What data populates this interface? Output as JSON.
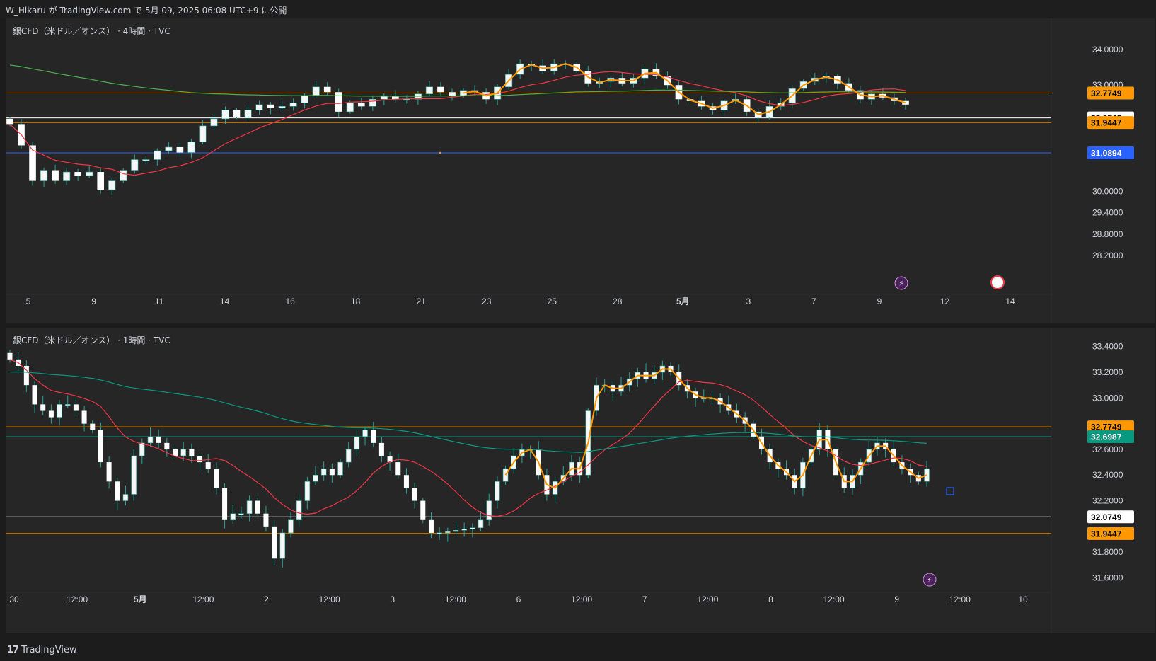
{
  "header": {
    "published": "W_Hikaru が TradingView.com で 5月 09, 2025 06:08 UTC+9 に公開"
  },
  "footer": {
    "brand": "TradingView",
    "logo": "tradingview-logo-icon"
  },
  "colors": {
    "up": "#ffffff",
    "down": "#ffffff",
    "wick": "#26a69a",
    "ma_fast": "#f23645",
    "ma_slow_top": "#4caf50",
    "ma_slow_bottom": "#089981",
    "zigzag": "#ff9800",
    "orange_line": "#ff9800",
    "white_line": "#ffffff",
    "blue_line": "#2962ff",
    "teal_line": "#089981"
  },
  "chart_data": [
    {
      "type": "candlestick",
      "title": "銀CFD（米ドル／オンス） · 4時間 · TVC",
      "x_ticks": [
        "5",
        "9",
        "11",
        "14",
        "16",
        "18",
        "21",
        "23",
        "25",
        "28",
        "5月",
        "3",
        "7",
        "9",
        "12",
        "14"
      ],
      "y_ticks": [
        "34.0000",
        "33.0000",
        "30.0000",
        "29.4000",
        "28.8000",
        "28.2000"
      ],
      "ylim": [
        27.5,
        34.6
      ],
      "price_labels": [
        {
          "value": "32.7749",
          "color": "#ff9800"
        },
        {
          "value": "32.0749",
          "color": "#ffffff"
        },
        {
          "value": "31.9447",
          "color": "#ff9800"
        },
        {
          "value": "31.0894",
          "color": "#2962ff"
        }
      ],
      "closes": [
        31.9,
        31.3,
        30.3,
        30.6,
        30.3,
        30.55,
        30.45,
        30.55,
        30.05,
        30.3,
        30.6,
        30.9,
        30.9,
        31.15,
        31.25,
        31.1,
        31.4,
        31.85,
        32.05,
        32.3,
        32.1,
        32.3,
        32.45,
        32.35,
        32.4,
        32.5,
        32.7,
        32.95,
        32.8,
        32.25,
        32.5,
        32.4,
        32.6,
        32.7,
        32.6,
        32.6,
        32.75,
        32.95,
        32.8,
        32.7,
        32.85,
        32.8,
        32.6,
        32.95,
        33.3,
        33.6,
        33.55,
        33.4,
        33.6,
        33.6,
        33.4,
        33.05,
        33.1,
        33.2,
        33.05,
        33.2,
        33.45,
        33.25,
        33.0,
        32.6,
        32.55,
        32.4,
        32.3,
        32.55,
        32.6,
        32.25,
        32.1,
        32.4,
        32.5,
        32.9,
        33.1,
        33.2,
        33.25,
        33.05,
        32.85,
        32.6,
        32.75,
        32.65,
        32.55,
        32.45
      ],
      "annotations": [
        "lightning-event-icon",
        "us-flag-icon"
      ]
    },
    {
      "type": "candlestick",
      "title": "銀CFD（米ドル／オンス） · 1時間 · TVC",
      "x_ticks": [
        "30",
        "12:00",
        "5月",
        "12:00",
        "2",
        "12:00",
        "3",
        "12:00",
        "6",
        "12:00",
        "7",
        "12:00",
        "8",
        "12:00",
        "9",
        "12:00",
        "10"
      ],
      "y_ticks": [
        "33.4000",
        "33.2000",
        "33.0000",
        "32.6000",
        "32.4000",
        "32.2000",
        "31.8000",
        "31.6000"
      ],
      "ylim": [
        31.52,
        33.47
      ],
      "price_labels": [
        {
          "value": "32.7749",
          "color": "#ff9800"
        },
        {
          "value": "32.6987",
          "color": "#089981"
        },
        {
          "value": "32.0749",
          "color": "#ffffff"
        },
        {
          "value": "31.9447",
          "color": "#ff9800"
        }
      ],
      "closes": [
        33.3,
        33.25,
        33.1,
        32.95,
        32.9,
        32.85,
        32.95,
        32.95,
        32.9,
        32.8,
        32.75,
        32.5,
        32.35,
        32.2,
        32.25,
        32.55,
        32.65,
        32.7,
        32.65,
        32.6,
        32.55,
        32.6,
        32.55,
        32.5,
        32.45,
        32.3,
        32.05,
        32.1,
        32.1,
        32.2,
        32.1,
        32.0,
        31.75,
        31.95,
        32.05,
        32.2,
        32.35,
        32.4,
        32.45,
        32.4,
        32.5,
        32.6,
        32.7,
        32.75,
        32.65,
        32.55,
        32.5,
        32.4,
        32.3,
        32.2,
        32.05,
        31.95,
        31.95,
        31.96,
        31.97,
        31.98,
        31.99,
        32.05,
        32.2,
        32.35,
        32.45,
        32.55,
        32.6,
        32.6,
        32.4,
        32.25,
        32.35,
        32.4,
        32.5,
        32.4,
        32.9,
        33.1,
        33.1,
        33.05,
        33.1,
        33.15,
        33.2,
        33.15,
        33.2,
        33.25,
        33.2,
        33.1,
        33.05,
        33.0,
        33.0,
        33.0,
        32.95,
        32.9,
        32.85,
        32.8,
        32.7,
        32.6,
        32.5,
        32.45,
        32.4,
        32.3,
        32.5,
        32.6,
        32.75,
        32.6,
        32.4,
        32.3,
        32.4,
        32.5,
        32.6,
        32.65,
        32.6,
        32.5,
        32.45,
        32.4,
        32.35,
        32.45
      ]
    }
  ]
}
